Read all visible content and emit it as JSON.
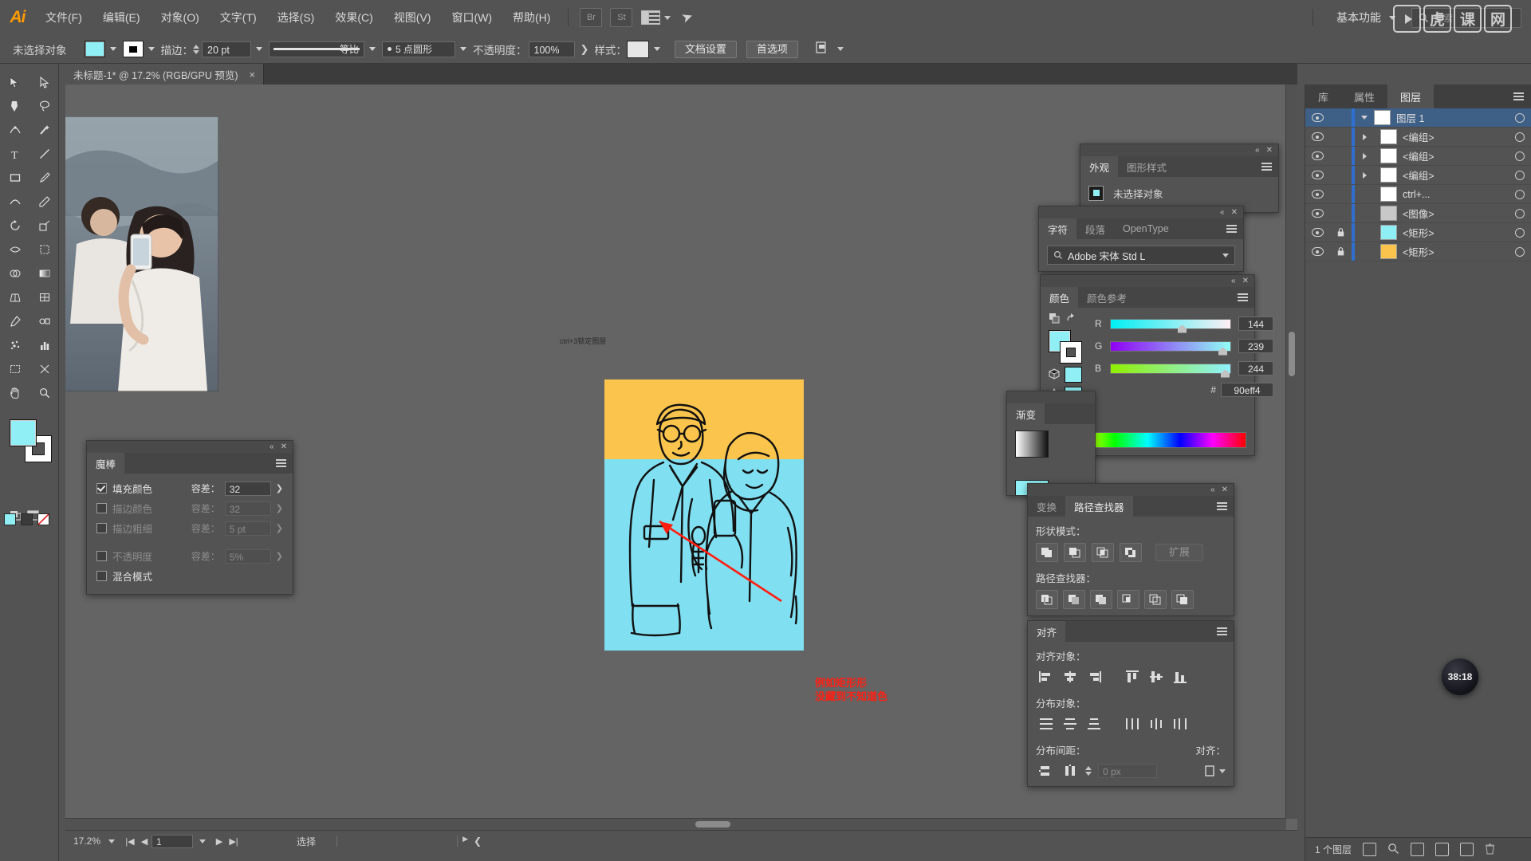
{
  "app": {
    "logo": "Ai",
    "menus": [
      "文件(F)",
      "编辑(E)",
      "对象(O)",
      "文字(T)",
      "选择(S)",
      "效果(C)",
      "视图(V)",
      "窗口(W)",
      "帮助(H)"
    ],
    "bridge_label": "Br",
    "stock_label": "St",
    "workspace": "基本功能",
    "search_placeholder": "搜索",
    "watermark": "虎课网"
  },
  "control_bar": {
    "selection_status": "未选择对象",
    "fill_color": "#90eff4",
    "stroke_label": "描边：",
    "stroke_weight": "20 pt",
    "stroke_profile_label": "等比",
    "brush_label": "5 点圆形",
    "opacity_label": "不透明度：",
    "opacity_value": "100%",
    "style_label": "样式：",
    "doc_setup_button": "文档设置",
    "preferences_button": "首选项"
  },
  "document_tab": {
    "title": "未标题-1* @ 17.2% (RGB/GPU 预览)",
    "close": "×"
  },
  "toolbar": {
    "tools": [
      {
        "name": "selection-tool",
        "glyph": "▶",
        "selected": false
      },
      {
        "name": "direct-selection-tool",
        "glyph": "▷",
        "selected": false
      },
      {
        "name": "magic-wand-tool",
        "glyph": "✦",
        "selected": true
      },
      {
        "name": "lasso-tool",
        "glyph": "◌",
        "selected": false
      },
      {
        "name": "pen-tool",
        "glyph": "✒",
        "selected": false
      },
      {
        "name": "curvature-tool",
        "glyph": "⌒",
        "selected": false
      },
      {
        "name": "type-tool",
        "glyph": "T",
        "selected": false
      },
      {
        "name": "line-segment-tool",
        "glyph": "╱",
        "selected": false
      },
      {
        "name": "rectangle-tool",
        "glyph": "▭",
        "selected": false
      },
      {
        "name": "paintbrush-tool",
        "glyph": "🖌",
        "selected": false
      },
      {
        "name": "shaper-tool",
        "glyph": "◠",
        "selected": false
      },
      {
        "name": "pencil-tool",
        "glyph": "✎",
        "selected": false
      },
      {
        "name": "rotate-tool",
        "glyph": "↻",
        "selected": false
      },
      {
        "name": "scale-tool",
        "glyph": "⤢",
        "selected": false
      },
      {
        "name": "width-tool",
        "glyph": "⧓",
        "selected": false
      },
      {
        "name": "free-transform-tool",
        "glyph": "⬚",
        "selected": false
      },
      {
        "name": "shape-builder-tool",
        "glyph": "⬗",
        "selected": false
      },
      {
        "name": "gradient-tool",
        "glyph": "▤",
        "selected": false
      },
      {
        "name": "perspective-grid-tool",
        "glyph": "⊞",
        "selected": false
      },
      {
        "name": "mesh-tool",
        "glyph": "⊟",
        "selected": false
      },
      {
        "name": "eyedropper-tool",
        "glyph": "💧",
        "selected": false
      },
      {
        "name": "blend-tool",
        "glyph": "❖",
        "selected": false
      },
      {
        "name": "symbol-sprayer-tool",
        "glyph": "✳",
        "selected": false
      },
      {
        "name": "column-graph-tool",
        "glyph": "▥",
        "selected": false
      },
      {
        "name": "artboard-tool",
        "glyph": "⬓",
        "selected": false
      },
      {
        "name": "slice-tool",
        "glyph": "✂",
        "selected": false
      },
      {
        "name": "hand-tool",
        "glyph": "✋",
        "selected": false
      },
      {
        "name": "zoom-tool",
        "glyph": "🔍",
        "selected": false
      }
    ],
    "fill_color": "#90eff4",
    "stroke_color": "#ffffff"
  },
  "canvas": {
    "note_text": "ctrl+3锁定图层",
    "artboard_top_color": "#fbc44c",
    "artboard_bottom_color": "#80dff0",
    "annotation_lines": [
      "例如矩形形",
      "没藏到不知道色"
    ],
    "annotation_color": "#ff1f12"
  },
  "status_bar": {
    "zoom": "17.2%",
    "page": "1",
    "mode": "选择"
  },
  "layers_panel": {
    "tabs": [
      "库",
      "属性",
      "图层"
    ],
    "active_tab": "图层",
    "rows": [
      {
        "name": "图层 1",
        "indent": 0,
        "has_disclosure": true,
        "expanded": true,
        "selected": true,
        "locked": false,
        "thumb": "#ffffff"
      },
      {
        "name": "<编组>",
        "indent": 1,
        "has_disclosure": true,
        "expanded": false,
        "selected": false,
        "locked": false,
        "thumb": "#ffffff"
      },
      {
        "name": "<编组>",
        "indent": 1,
        "has_disclosure": true,
        "expanded": false,
        "selected": false,
        "locked": false,
        "thumb": "#ffffff"
      },
      {
        "name": "<编组>",
        "indent": 1,
        "has_disclosure": true,
        "expanded": false,
        "selected": false,
        "locked": false,
        "thumb": "#ffffff"
      },
      {
        "name": "ctrl+...",
        "indent": 1,
        "has_disclosure": false,
        "expanded": false,
        "selected": false,
        "locked": false,
        "thumb": "#ffffff"
      },
      {
        "name": "<图像>",
        "indent": 1,
        "has_disclosure": false,
        "expanded": false,
        "selected": false,
        "locked": false,
        "thumb": "#c8c8c8"
      },
      {
        "name": "<矩形>",
        "indent": 1,
        "has_disclosure": false,
        "expanded": false,
        "selected": false,
        "locked": true,
        "thumb": "#90eff4"
      },
      {
        "name": "<矩形>",
        "indent": 1,
        "has_disclosure": false,
        "expanded": false,
        "selected": false,
        "locked": true,
        "thumb": "#fbc44c"
      }
    ],
    "footer_count": "1 个图层"
  },
  "magic_wand_panel": {
    "tab": "魔棒",
    "rows": [
      {
        "label": "填充颜色",
        "checked": true,
        "tol_label": "容差：",
        "tol_value": "32",
        "dim": false
      },
      {
        "label": "描边颜色",
        "checked": false,
        "tol_label": "容差：",
        "tol_value": "32",
        "dim": true
      },
      {
        "label": "描边粗细",
        "checked": false,
        "tol_label": "容差：",
        "tol_value": "5 pt",
        "dim": true
      },
      {
        "label": "不透明度",
        "checked": false,
        "tol_label": "容差：",
        "tol_value": "5%",
        "dim": true
      },
      {
        "label": "混合模式",
        "checked": false,
        "tol_label": "",
        "tol_value": "",
        "dim": false
      }
    ]
  },
  "appearance_panel": {
    "tabs": [
      "外观",
      "图形样式"
    ],
    "active_tab": "外观",
    "status": "未选择对象"
  },
  "character_panel": {
    "tabs": [
      "字符",
      "段落",
      "OpenType"
    ],
    "active_tab": "字符",
    "font_family": "Adobe 宋体 Std L"
  },
  "color_panel": {
    "tabs": [
      "颜色",
      "颜色参考"
    ],
    "active_tab": "颜色",
    "channels": [
      {
        "label": "R",
        "value": "144",
        "pct": 56
      },
      {
        "label": "G",
        "value": "239",
        "pct": 93
      },
      {
        "label": "B",
        "value": "244",
        "pct": 95
      }
    ],
    "hex_label": "#",
    "hex_value": "90eff4",
    "current_color": "#90eff4"
  },
  "gradient_panel": {
    "tab": "渐变"
  },
  "pathfinder_panel": {
    "tabs": [
      "变换",
      "路径查找器"
    ],
    "active_tab": "路径查找器",
    "shape_modes_label": "形状模式：",
    "expand_button": "扩展",
    "pathfinders_label": "路径查找器："
  },
  "align_panel": {
    "tab": "对齐",
    "align_objects_label": "对齐对象：",
    "distribute_objects_label": "分布对象：",
    "distribute_spacing_label": "分布间距：",
    "align_to_label": "对齐：",
    "spacing_value": "0 px"
  },
  "timer": {
    "value": "38:18"
  }
}
